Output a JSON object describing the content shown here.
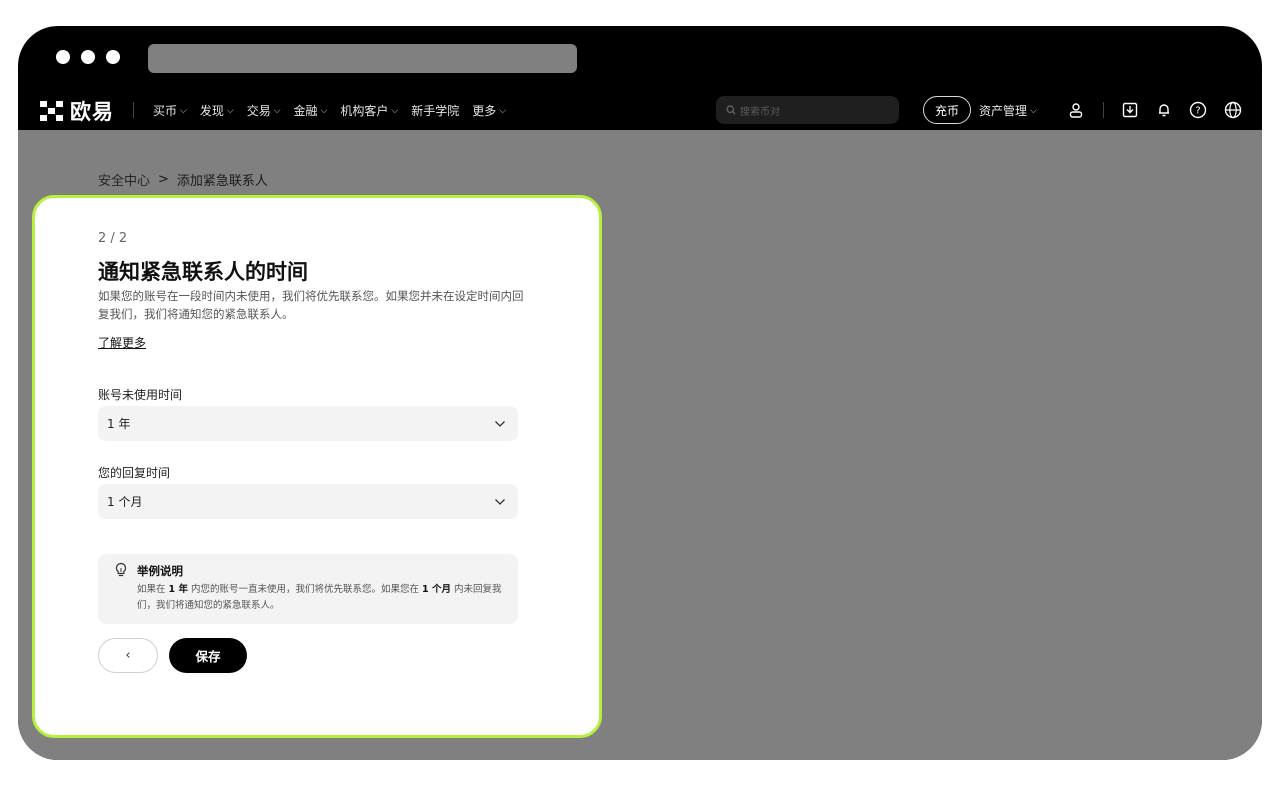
{
  "browser": {
    "url": ""
  },
  "brand": {
    "name": "欧易"
  },
  "nav": {
    "items": [
      {
        "label": "买币",
        "has_dropdown": true
      },
      {
        "label": "发现",
        "has_dropdown": true
      },
      {
        "label": "交易",
        "has_dropdown": true
      },
      {
        "label": "金融",
        "has_dropdown": true
      },
      {
        "label": "机构客户",
        "has_dropdown": true
      },
      {
        "label": "新手学院",
        "has_dropdown": false
      },
      {
        "label": "更多",
        "has_dropdown": true
      }
    ],
    "search_placeholder": "搜索币对",
    "deposit_label": "充币",
    "assets_label": "资产管理"
  },
  "breadcrumb": {
    "parent": "安全中心",
    "separator": ">",
    "current": "添加紧急联系人"
  },
  "form": {
    "step": "2 / 2",
    "title": "通知紧急联系人的时间",
    "description": "如果您的账号在一段时间内未使用，我们将优先联系您。如果您并未在设定时间内回复我们，我们将通知您的紧急联系人。",
    "learn_more": "了解更多",
    "inactive_label": "账号未使用时间",
    "inactive_value": "1 年",
    "reply_label": "您的回复时间",
    "reply_value": "1 个月",
    "example": {
      "title": "举例说明",
      "text_1": "如果在",
      "bold_1": "1 年",
      "text_2": "内您的账号一直未使用，我们将优先联系您。如果您在",
      "bold_2": "1 个月",
      "text_3": "内未回复我们，我们将通知您的紧急联系人。"
    },
    "back_label": "‹",
    "save_label": "保存"
  },
  "colors": {
    "accent_border": "#b8f03f",
    "overlay": "#808080",
    "primary_button": "#000000"
  },
  "icons": [
    "logo-icon",
    "search-icon",
    "user-icon",
    "download-icon",
    "bell-icon",
    "help-icon",
    "globe-icon",
    "lightbulb-icon",
    "chevron-down-icon"
  ]
}
